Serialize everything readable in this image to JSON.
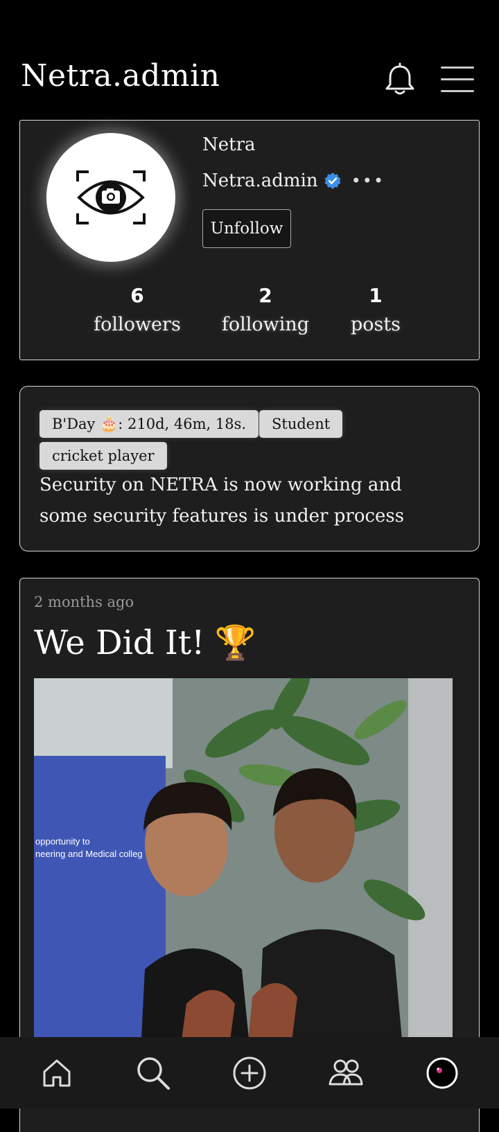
{
  "header": {
    "title": "Netra.admin"
  },
  "profile": {
    "display_name": "Netra",
    "username": "Netra.admin",
    "more": "•••",
    "unfollow_label": "Unfollow",
    "stats": [
      {
        "value": "6",
        "label": "followers"
      },
      {
        "value": "2",
        "label": "following"
      },
      {
        "value": "1",
        "label": "posts"
      }
    ]
  },
  "bio": {
    "badges": [
      {
        "text": "B'Day 🎂: 210d, 46m, 18s."
      },
      {
        "text": "Student"
      },
      {
        "text": "cricket player"
      }
    ],
    "text": "Security on NETRA is now working and some security features is under process"
  },
  "post": {
    "time": "2 months ago",
    "title": "We Did It!",
    "title_emoji": "🏆",
    "image_banner_line1": "opportunity to",
    "image_banner_line2": "neering and Medical colleg"
  },
  "icons": {
    "bell": "bell-icon",
    "menu": "menu-icon",
    "home": "home-icon",
    "search": "search-icon",
    "add": "add-circle-icon",
    "people": "people-icon",
    "profile": "profile-avatar-icon",
    "verified": "verified-badge-icon"
  },
  "colors": {
    "background": "#000000",
    "card": "#1e1e1e",
    "verified": "#3d8fe6",
    "badge": "#d9d9d9"
  }
}
